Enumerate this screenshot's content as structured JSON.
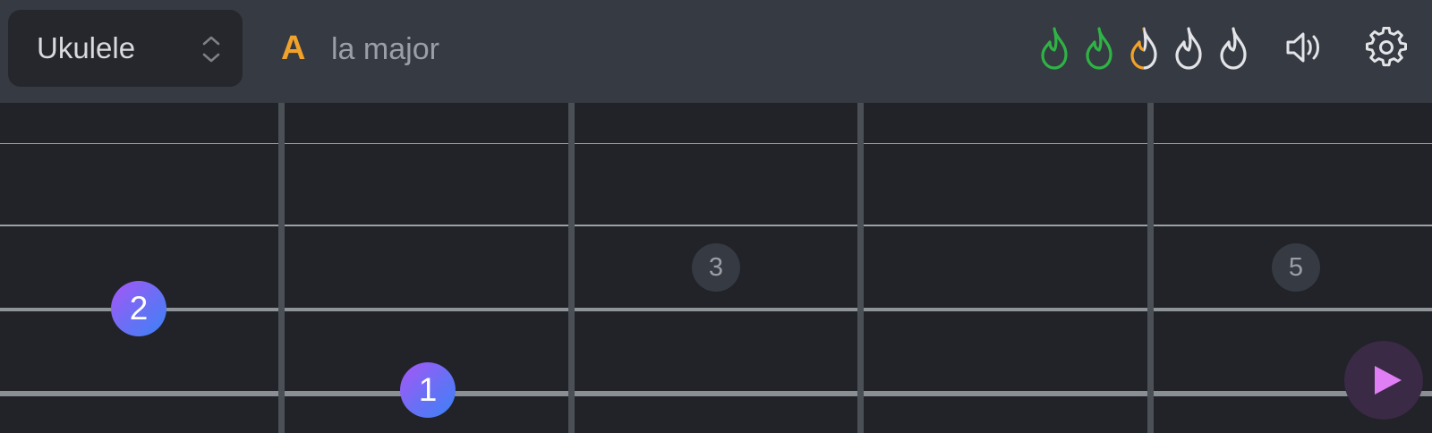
{
  "header": {
    "instrument": {
      "selected": "Ukulele",
      "chevron_icon": "chevron-up-down-icon"
    },
    "chord": {
      "root_letter": "A",
      "name": "la major"
    },
    "streak": {
      "icon": "flame-icon",
      "progress": [
        1,
        1,
        0.5,
        0,
        0
      ],
      "colors": {
        "complete": "#2fb345",
        "partial": "#f0a22a",
        "empty": "#e3e4e8"
      }
    },
    "sound_icon": "speaker-icon",
    "settings_icon": "gear-icon"
  },
  "fretboard": {
    "fret_markers": [
      {
        "label": "3"
      },
      {
        "label": "5"
      }
    ],
    "fingers": [
      {
        "label": "2"
      },
      {
        "label": "1"
      }
    ],
    "play_icon": "play-icon"
  },
  "colors": {
    "accent": "#f0a22a",
    "finger_gradient_start": "#a855f7",
    "finger_gradient_end": "#3b82f6",
    "play": "#e07ef5"
  }
}
